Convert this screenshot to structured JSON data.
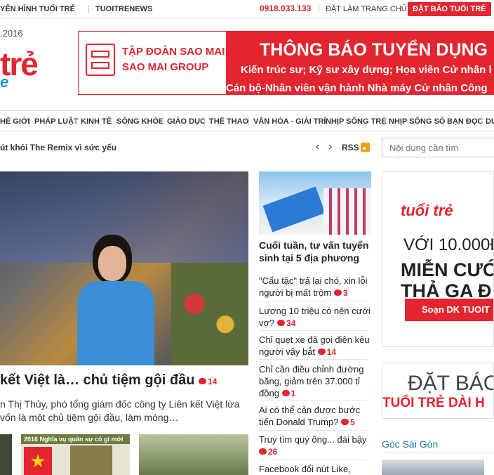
{
  "topbar": {
    "links": [
      "YÊN HÌNH TUỔI TRẺ",
      "TUOITRENEWS"
    ],
    "phone": "0918.033.133",
    "homepage": "ĐẶT LÀM TRANG CHỦ",
    "subscribe": "ĐẶT BÁO TUỔI TRẺ"
  },
  "date": ".2016",
  "logo": {
    "text": "trẻ",
    "sub": "e"
  },
  "banner": {
    "company1": "TẬP ĐOÀN SAO MAI",
    "company2": "SAO MAI GROUP",
    "headline": "THÔNG BÁO TUYỂN DỤNG N",
    "line2": "Kiến trúc sư; Kỹ sư xây dựng; Họa viên      Cử nhân l",
    "line3": "Cán bộ-Nhân viên vận hành Nhà máy      Cử nhân Công"
  },
  "nav": [
    "HẾ GIỚI",
    "PHÁP LUẬT",
    "KINH TẾ",
    "SỐNG KHỎE",
    "GIÁO DỤC",
    "THỂ THAO",
    "VĂN HÓA - GIẢI TRÍ",
    "NHỊP SỐNG TRẺ",
    "NHỊP SỐNG SỐ",
    "BẠN ĐỌC",
    "DU"
  ],
  "ticker": {
    "text": "út khỏi The Remix vì sức yếu",
    "prev": "‹",
    "next": "›",
    "rss": "RSS"
  },
  "search": {
    "placeholder": "Nội dung cần tìm"
  },
  "hero": {
    "title": "kết Việt là… chủ tiệm gội đầu",
    "comments": "14",
    "summary": "n Thị Thủy, phó tổng giám đốc công ty Liên kết Việt lừa vốn là một chủ tiệm gội đầu, làm móng…"
  },
  "thumbs": {
    "banner": "2016 Nghĩa vụ quân sự có gì mới"
  },
  "middle": {
    "featured": "Cuối tuần, tư vấn tuyển sinh tại 5 địa phương",
    "items": [
      {
        "title": "\"Cẩu tặc\" trả lại chó, xin lỗi người bị mất trộm",
        "comments": "3"
      },
      {
        "title": "Lương 10 triệu có nên cưới vợ?",
        "comments": "34"
      },
      {
        "title": "Chỉ quẹt xe đã gọi điện kêu người vậy bắt",
        "comments": "14"
      },
      {
        "title": "Chỉ cần điều chỉnh đường băng, giảm trên 37.000 tỉ đồng",
        "comments": "1"
      },
      {
        "title": "Ai có thể cản được bước tiến Donald Trump?",
        "comments": "5"
      },
      {
        "title": "Truy tìm quý ông... đái bậy",
        "comments": "26"
      },
      {
        "title": "Facebook đổi nút Like,",
        "comments": ""
      }
    ]
  },
  "right": {
    "ad1": {
      "logo": "tuổi trẻ",
      "l1": "VỚI 10.000Đ",
      "l2": "MIỄN CƯỚ",
      "l3": "THẢ GA Đ",
      "cta": "Soạn DK TUOIT"
    },
    "ad2": {
      "l1": "ĐẶT BÁO",
      "l2": "TUỔI TRẺ DÀI H"
    },
    "section": "Góc Sài Gòn"
  },
  "colors": {
    "brand_red": "#e2252f",
    "link_blue": "#1a7ab0"
  }
}
